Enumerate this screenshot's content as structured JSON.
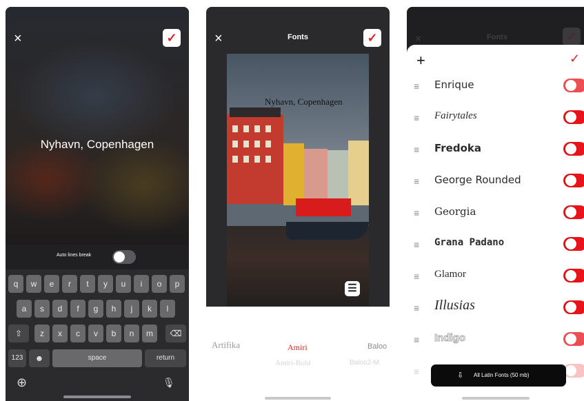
{
  "editor": {
    "caption": "Nyhavn, Copenhagen",
    "close_icon": "×",
    "confirm_icon": "✓",
    "auto_lines_break_label": "Auto lines break",
    "auto_lines_break_on": true
  },
  "keyboard": {
    "row1": [
      "q",
      "w",
      "e",
      "r",
      "t",
      "y",
      "u",
      "i",
      "o",
      "p"
    ],
    "row2": [
      "a",
      "s",
      "d",
      "f",
      "g",
      "h",
      "j",
      "k",
      "l"
    ],
    "row3": [
      "z",
      "x",
      "c",
      "v",
      "b",
      "n",
      "m"
    ],
    "shift_icon": "⇧",
    "delete_icon": "⌫",
    "numbers_key": "123",
    "emoji_icon": "☻",
    "space_key": "space",
    "return_key": "return",
    "globe_icon": "⊕",
    "mic_icon": "🎙"
  },
  "fonts_preview": {
    "title": "Fonts",
    "caption": "Nyhavn, Copenhagen",
    "list_icon": "☰",
    "font_options": [
      "Artifika",
      "Amiri",
      "Amiri-Bold",
      "Baloo",
      "Baloo2-M"
    ],
    "selected_font": "Amiri",
    "accent": "#e02424"
  },
  "font_manager": {
    "title": "Fonts",
    "add_icon": "+",
    "confirm_icon": "✓",
    "fonts": [
      {
        "name": "Enrique",
        "enabled": true
      },
      {
        "name": "Fairytales",
        "enabled": true
      },
      {
        "name": "Fredoka",
        "enabled": true
      },
      {
        "name": "George Rounded",
        "enabled": true
      },
      {
        "name": "Georgia",
        "enabled": true
      },
      {
        "name": "Grana Padano",
        "enabled": true
      },
      {
        "name": "Glamor",
        "enabled": true
      },
      {
        "name": "Illusias",
        "enabled": true
      },
      {
        "name": "Indigo",
        "enabled": true
      },
      {
        "name": "",
        "enabled": true
      }
    ],
    "download_label": "All Latin Fonts (50 mb)",
    "download_icon": "⇩",
    "toggle_color": "#e8141a"
  }
}
